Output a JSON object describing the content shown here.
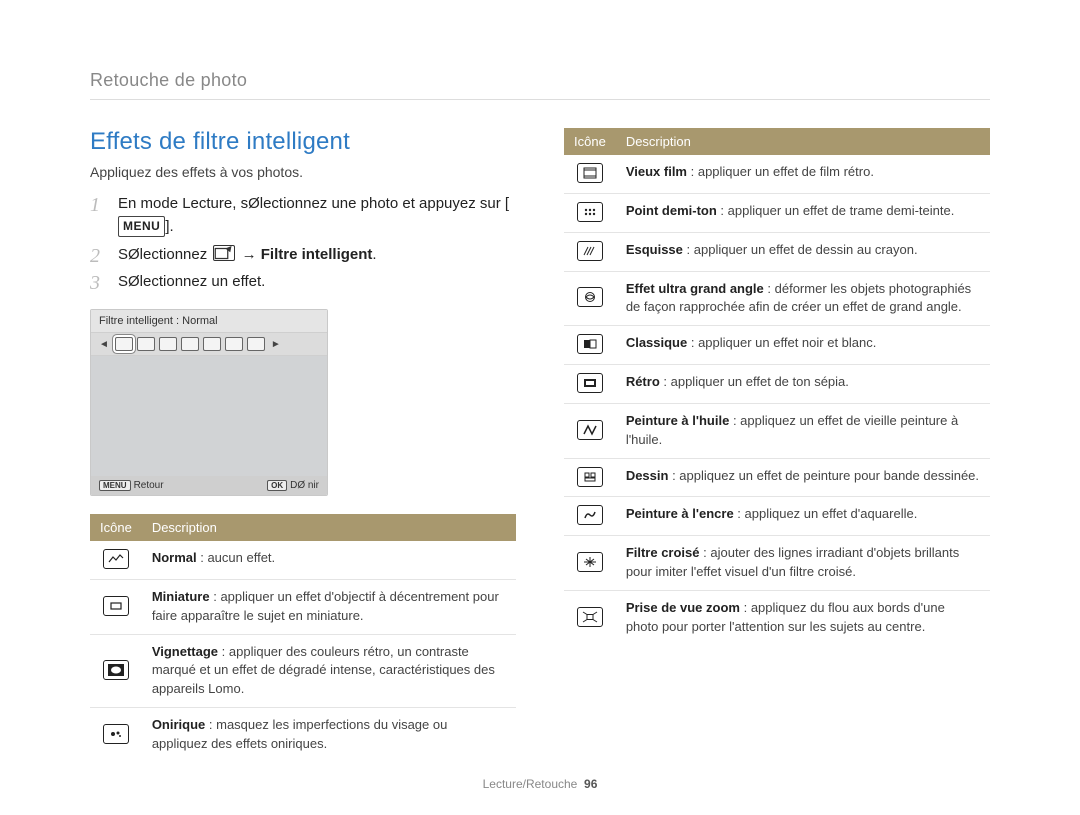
{
  "breadcrumb": "Retouche de photo",
  "section_title": "Effets de filtre intelligent",
  "subtitle": "Appliquez des effets à vos photos.",
  "steps": {
    "s1_a": "En mode Lecture, sØlectionnez une photo et appuyez sur [",
    "s1_key": "MENU",
    "s1_b": "].",
    "s2_a": "SØlectionnez",
    "s2_arrow": "→",
    "s2_b": "Filtre intelligent",
    "s2_c": ".",
    "s3": "SØlectionnez un effet."
  },
  "camera": {
    "top_label": "Filtre intelligent : Normal",
    "back_key": "MENU",
    "back_label": "Retour",
    "ok_key": "OK",
    "ok_label": "DØ nir"
  },
  "table_headers": {
    "icon": "Icône",
    "desc": "Description"
  },
  "left_rows": [
    {
      "term": "Normal",
      "sep": " : ",
      "text": "aucun effet."
    },
    {
      "term": "Miniature",
      "sep": " : ",
      "text": "appliquer un effet d'objectif à décentrement pour faire apparaître le sujet en miniature."
    },
    {
      "term": "Vignettage",
      "sep": " : ",
      "text": "appliquer des couleurs rétro, un contraste marqué et un effet de dégradé intense, caractéristiques des appareils Lomo."
    },
    {
      "term": "Onirique",
      "sep": " : ",
      "text": "masquez les imperfections du visage ou appliquez des effets oniriques."
    }
  ],
  "right_rows": [
    {
      "term": "Vieux film",
      "sep": " : ",
      "text": "appliquer un effet de film rétro."
    },
    {
      "term": "Point demi-ton",
      "sep": " : ",
      "text": "appliquer un effet de trame demi-teinte."
    },
    {
      "term": "Esquisse",
      "sep": " : ",
      "text": "appliquer un effet de dessin au crayon."
    },
    {
      "term": "Effet ultra grand angle",
      "sep": " : ",
      "text": "déformer les objets photographiés de façon rapprochée afin de créer un effet de grand angle."
    },
    {
      "term": "Classique",
      "sep": " : ",
      "text": "appliquer un effet noir et blanc."
    },
    {
      "term": "Rétro",
      "sep": " : ",
      "text": "appliquer un effet de ton sépia."
    },
    {
      "term": "Peinture à l'huile",
      "sep": " : ",
      "text": "appliquez un effet de vieille peinture à l'huile."
    },
    {
      "term": "Dessin",
      "sep": " : ",
      "text": "appliquez un effet de peinture pour bande dessinée."
    },
    {
      "term": "Peinture à l'encre",
      "sep": " : ",
      "text": "appliquez un effet d'aquarelle."
    },
    {
      "term": "Filtre croisé",
      "sep": " : ",
      "text": "ajouter des lignes irradiant d'objets brillants pour imiter l'effet visuel d'un filtre croisé."
    },
    {
      "term": "Prise de vue zoom",
      "sep": " : ",
      "text": "appliquez du flou aux bords d'une photo pour porter l'attention sur les sujets au centre."
    }
  ],
  "footer": {
    "section": "Lecture/Retouche",
    "page": "96"
  }
}
